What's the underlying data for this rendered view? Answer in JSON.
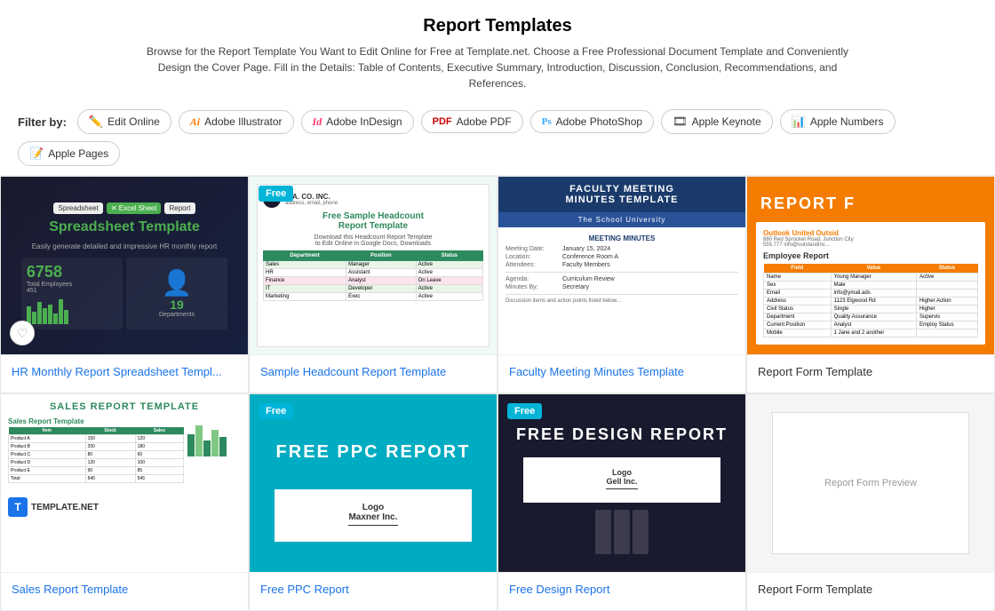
{
  "page": {
    "title": "Report Templates",
    "description": "Browse for the Report Template You Want to Edit Online for Free at Template.net. Choose a Free Professional Document Template and Conveniently Design the Cover Page. Fill in the Details: Table of Contents, Executive Summary, Introduction, Discussion, Conclusion, Recommendations, and References."
  },
  "filter": {
    "label": "Filter by:",
    "buttons": [
      {
        "id": "edit-online",
        "icon": "✏️",
        "label": "Edit Online"
      },
      {
        "id": "adobe-illustrator",
        "icon": "Ai",
        "label": "Adobe Illustrator"
      },
      {
        "id": "adobe-indesign",
        "icon": "Id",
        "label": "Adobe InDesign"
      },
      {
        "id": "adobe-pdf",
        "icon": "📄",
        "label": "Adobe PDF"
      },
      {
        "id": "adobe-photoshop",
        "icon": "Ps",
        "label": "Adobe PhotoShop"
      },
      {
        "id": "apple-keynote",
        "icon": "🎞",
        "label": "Apple Keynote"
      },
      {
        "id": "apple-numbers",
        "icon": "📊",
        "label": "Apple Numbers"
      },
      {
        "id": "apple-pages",
        "icon": "📝",
        "label": "Apple Pages"
      }
    ]
  },
  "cards": [
    {
      "id": "card-1",
      "title": "HR Monthly Report Spreadsheet Templ...",
      "free": false,
      "thumb_type": "spreadsheet"
    },
    {
      "id": "card-2",
      "title": "Sample Headcount Report Template",
      "free": true,
      "thumb_type": "headcount"
    },
    {
      "id": "card-3",
      "title": "Faculty Meeting Minutes Template",
      "free": false,
      "thumb_type": "faculty"
    },
    {
      "id": "card-4",
      "title": "Report Form Template",
      "free": false,
      "thumb_type": "report-form",
      "partial": true
    },
    {
      "id": "card-5",
      "title": "Sales Report Template",
      "free": false,
      "thumb_type": "sales"
    },
    {
      "id": "card-6",
      "title": "Free PPC Report",
      "free": true,
      "thumb_type": "ppc"
    },
    {
      "id": "card-7",
      "title": "Free Design Report",
      "free": true,
      "thumb_type": "design"
    },
    {
      "id": "card-8",
      "title": "Report Form Template",
      "free": false,
      "thumb_type": "report-form-2"
    }
  ]
}
